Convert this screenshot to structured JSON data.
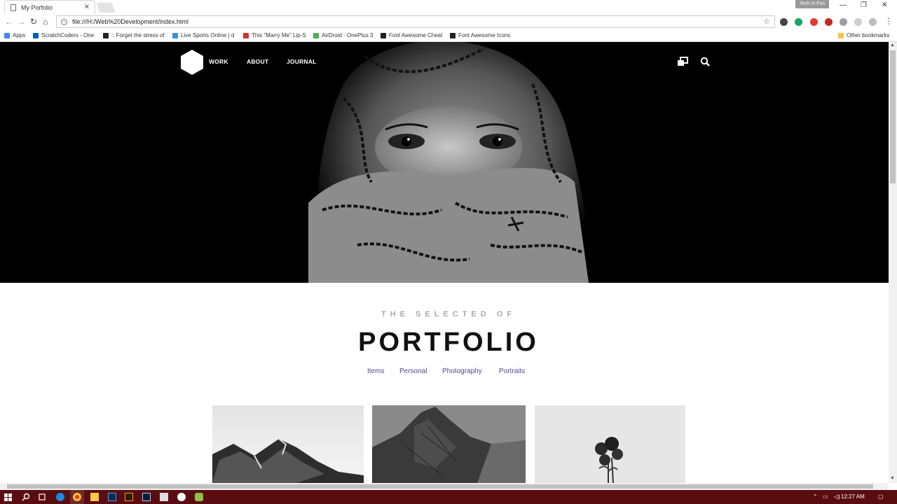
{
  "browser": {
    "tab_title": "My Porfolio",
    "url": "file:///H:/Web%20Development/index.html",
    "profile_label": "Tech In Fun",
    "bookmarks": [
      {
        "label": "Apps",
        "icon": "apps-grid-icon",
        "color": "#4285f4"
      },
      {
        "label": "ScratchCoders - One",
        "icon": "onedrive-icon",
        "color": "#0a5fb4"
      },
      {
        "label": ":: Forget the stress of",
        "icon": "page-icon",
        "color": "#222222"
      },
      {
        "label": "Live Sports Online | d",
        "icon": "arrow-icon",
        "color": "#3b8fd9"
      },
      {
        "label": "This \"Marry Me\" Lip-S",
        "icon": "shield-icon",
        "color": "#d32f2f"
      },
      {
        "label": "AirDroid - OnePlus 3",
        "icon": "airdroid-icon",
        "color": "#4caf50"
      },
      {
        "label": "Font Awesome Cheat",
        "icon": "flag-icon",
        "color": "#222222"
      },
      {
        "label": "Font Awesome Icons",
        "icon": "flag-icon",
        "color": "#222222"
      }
    ],
    "other_bookmarks": "Other bookmarks"
  },
  "site": {
    "nav": {
      "links": [
        "WORK",
        "ABOUT",
        "JOURNAL"
      ]
    },
    "portfolio": {
      "subtitle": "THE SELECTED OF",
      "title": "PORTFOLIO",
      "filters": [
        "Items",
        "Personal",
        "Photography",
        "Portraits"
      ]
    }
  },
  "taskbar": {
    "time": "12:27 AM"
  },
  "colors": {
    "hero_bg": "#000000",
    "filter_link": "#4a4a8a",
    "taskbar": "#5a0d10"
  }
}
